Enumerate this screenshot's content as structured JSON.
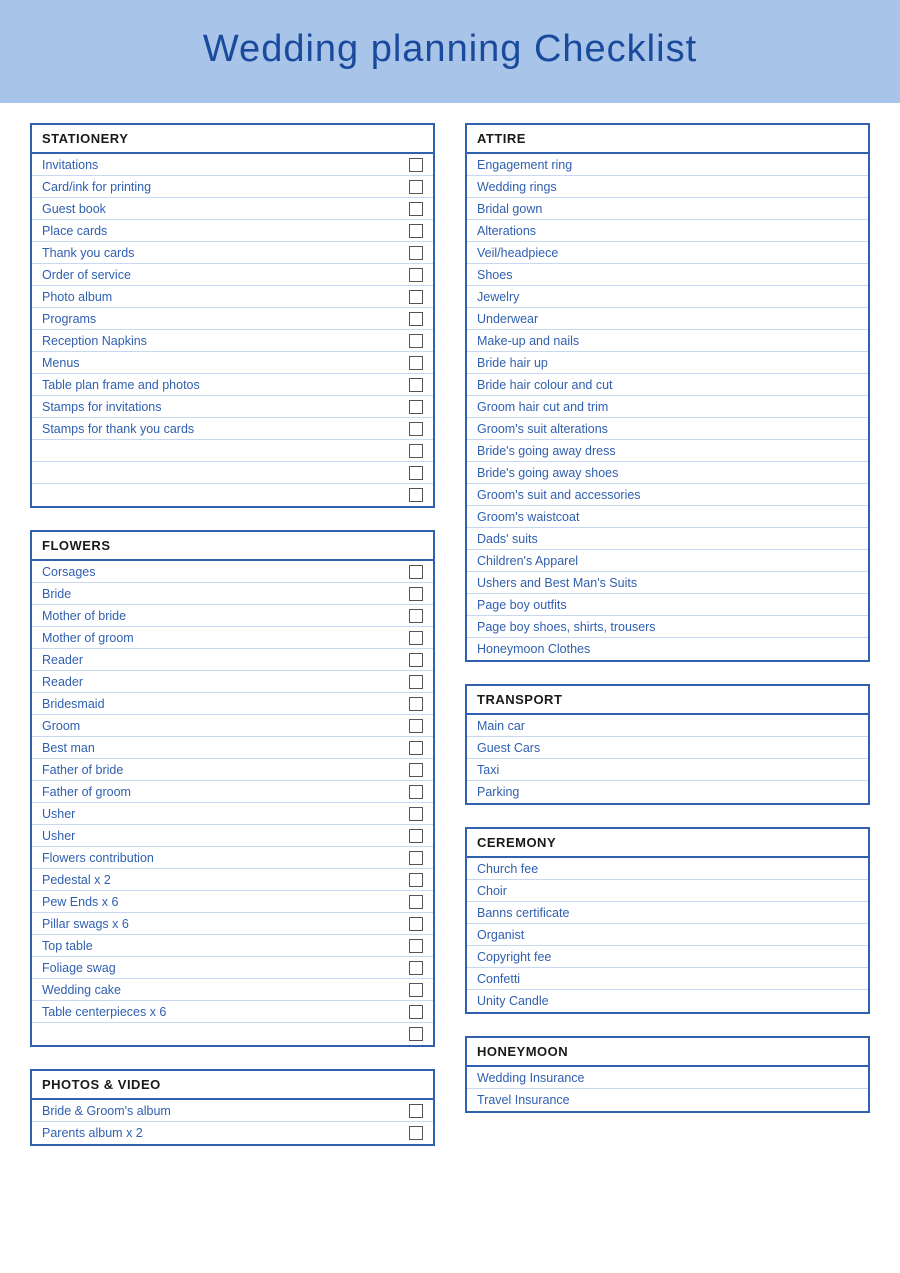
{
  "header": {
    "title": "Wedding planning Checklist"
  },
  "sections": {
    "left": [
      {
        "id": "stationery",
        "title": "STATIONERY",
        "items": [
          {
            "label": "Invitations",
            "hasCheck": true
          },
          {
            "label": "Card/ink for printing",
            "hasCheck": true
          },
          {
            "label": "Guest book",
            "hasCheck": true
          },
          {
            "label": "Place cards",
            "hasCheck": true
          },
          {
            "label": "Thank you cards",
            "hasCheck": true
          },
          {
            "label": "Order of service",
            "hasCheck": true
          },
          {
            "label": "Photo album",
            "hasCheck": true
          },
          {
            "label": "Programs",
            "hasCheck": true
          },
          {
            "label": "Reception Napkins",
            "hasCheck": true
          },
          {
            "label": "Menus",
            "hasCheck": true
          },
          {
            "label": "Table plan frame and photos",
            "hasCheck": true
          },
          {
            "label": "Stamps for invitations",
            "hasCheck": true
          },
          {
            "label": "Stamps for thank you cards",
            "hasCheck": true
          },
          {
            "label": "",
            "hasCheck": true
          },
          {
            "label": "",
            "hasCheck": true
          },
          {
            "label": "",
            "hasCheck": true
          }
        ]
      },
      {
        "id": "flowers",
        "title": "FLOWERS",
        "items": [
          {
            "label": "Corsages",
            "hasCheck": true
          },
          {
            "label": "Bride",
            "hasCheck": true
          },
          {
            "label": "Mother of bride",
            "hasCheck": true
          },
          {
            "label": "Mother of groom",
            "hasCheck": true
          },
          {
            "label": "Reader",
            "hasCheck": true
          },
          {
            "label": "Reader",
            "hasCheck": true
          },
          {
            "label": "Bridesmaid",
            "hasCheck": true
          },
          {
            "label": "Groom",
            "hasCheck": true
          },
          {
            "label": "Best man",
            "hasCheck": true
          },
          {
            "label": "Father of bride",
            "hasCheck": true
          },
          {
            "label": "Father of groom",
            "hasCheck": true
          },
          {
            "label": "Usher",
            "hasCheck": true
          },
          {
            "label": "Usher",
            "hasCheck": true
          },
          {
            "label": "Flowers contribution",
            "hasCheck": true
          },
          {
            "label": "Pedestal x 2",
            "hasCheck": true
          },
          {
            "label": "Pew Ends x 6",
            "hasCheck": true
          },
          {
            "label": "Pillar swags x 6",
            "hasCheck": true
          },
          {
            "label": "Top table",
            "hasCheck": true
          },
          {
            "label": "Foliage swag",
            "hasCheck": true
          },
          {
            "label": "Wedding cake",
            "hasCheck": true
          },
          {
            "label": "Table centerpieces x 6",
            "hasCheck": true
          },
          {
            "label": "",
            "hasCheck": true
          }
        ]
      },
      {
        "id": "photos-video",
        "title": "PHOTOS & VIDEO",
        "items": [
          {
            "label": "Bride & Groom's album",
            "hasCheck": true
          },
          {
            "label": "Parents album x 2",
            "hasCheck": true
          }
        ]
      }
    ],
    "right": [
      {
        "id": "attire",
        "title": "ATTIRE",
        "items": [
          {
            "label": "Engagement ring",
            "hasCheck": false
          },
          {
            "label": "Wedding rings",
            "hasCheck": false
          },
          {
            "label": "Bridal gown",
            "hasCheck": false
          },
          {
            "label": "Alterations",
            "hasCheck": false
          },
          {
            "label": "Veil/headpiece",
            "hasCheck": false
          },
          {
            "label": "Shoes",
            "hasCheck": false
          },
          {
            "label": "Jewelry",
            "hasCheck": false
          },
          {
            "label": "Underwear",
            "hasCheck": false
          },
          {
            "label": "Make-up and nails",
            "hasCheck": false
          },
          {
            "label": "Bride hair up",
            "hasCheck": false
          },
          {
            "label": "Bride hair colour and cut",
            "hasCheck": false
          },
          {
            "label": "Groom hair cut and trim",
            "hasCheck": false
          },
          {
            "label": "Groom's suit alterations",
            "hasCheck": false
          },
          {
            "label": "Bride's going away dress",
            "hasCheck": false
          },
          {
            "label": "Bride's going away shoes",
            "hasCheck": false
          },
          {
            "label": "Groom's suit and accessories",
            "hasCheck": false
          },
          {
            "label": "Groom's waistcoat",
            "hasCheck": false
          },
          {
            "label": "Dads' suits",
            "hasCheck": false
          },
          {
            "label": "Children's Apparel",
            "hasCheck": false
          },
          {
            "label": "Ushers and Best Man's Suits",
            "hasCheck": false
          },
          {
            "label": "Page boy outfits",
            "hasCheck": false
          },
          {
            "label": "Page boy shoes, shirts, trousers",
            "hasCheck": false
          },
          {
            "label": "Honeymoon Clothes",
            "hasCheck": false
          }
        ]
      },
      {
        "id": "transport",
        "title": "TRANSPORT",
        "items": [
          {
            "label": "Main car",
            "hasCheck": false
          },
          {
            "label": "Guest Cars",
            "hasCheck": false
          },
          {
            "label": "Taxi",
            "hasCheck": false
          },
          {
            "label": "Parking",
            "hasCheck": false
          }
        ]
      },
      {
        "id": "ceremony",
        "title": "CEREMONY",
        "items": [
          {
            "label": "Church fee",
            "hasCheck": false
          },
          {
            "label": "Choir",
            "hasCheck": false
          },
          {
            "label": "Banns certificate",
            "hasCheck": false
          },
          {
            "label": "Organist",
            "hasCheck": false
          },
          {
            "label": "Copyright fee",
            "hasCheck": false
          },
          {
            "label": "Confetti",
            "hasCheck": false
          },
          {
            "label": "Unity Candle",
            "hasCheck": false
          }
        ]
      },
      {
        "id": "honeymoon",
        "title": "HONEYMOON",
        "items": [
          {
            "label": "Wedding Insurance",
            "hasCheck": false
          },
          {
            "label": "Travel Insurance",
            "hasCheck": false
          }
        ]
      }
    ]
  }
}
